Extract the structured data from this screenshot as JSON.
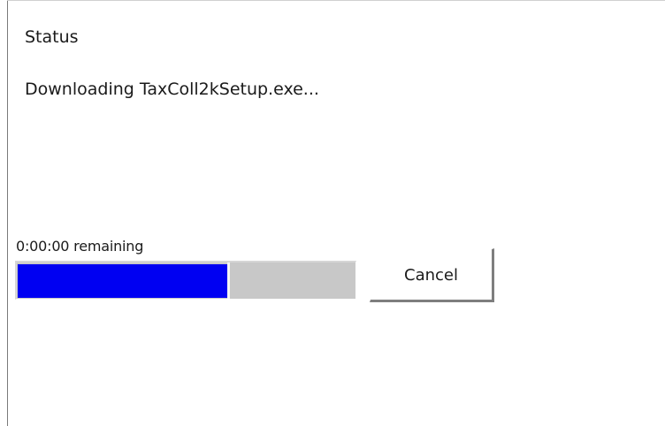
{
  "status": {
    "label": "Status",
    "message": "Downloading TaxColl2kSetup.exe..."
  },
  "progress": {
    "remaining_text": "0:00:00 remaining",
    "fraction": 0.62,
    "fill_color": "#0000f2",
    "track_color": "#c8c8c8"
  },
  "buttons": {
    "cancel_label": "Cancel"
  }
}
